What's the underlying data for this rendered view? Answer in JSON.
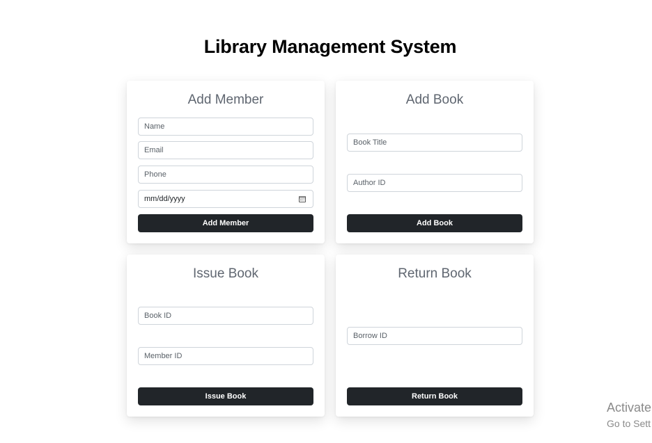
{
  "page": {
    "title": "Library Management System"
  },
  "add_member": {
    "title": "Add Member",
    "name_placeholder": "Name",
    "email_placeholder": "Email",
    "phone_placeholder": "Phone",
    "date_value": "mm/dd/yyyy",
    "button_label": "Add Member"
  },
  "add_book": {
    "title": "Add Book",
    "book_title_placeholder": "Book Title",
    "author_id_placeholder": "Author ID",
    "button_label": "Add Book"
  },
  "issue_book": {
    "title": "Issue Book",
    "book_id_placeholder": "Book ID",
    "member_id_placeholder": "Member ID",
    "button_label": "Issue Book"
  },
  "return_book": {
    "title": "Return Book",
    "borrow_id_placeholder": "Borrow ID",
    "button_label": "Return Book"
  },
  "watermark": {
    "line1": "Activate",
    "line2": "Go to Sett"
  }
}
